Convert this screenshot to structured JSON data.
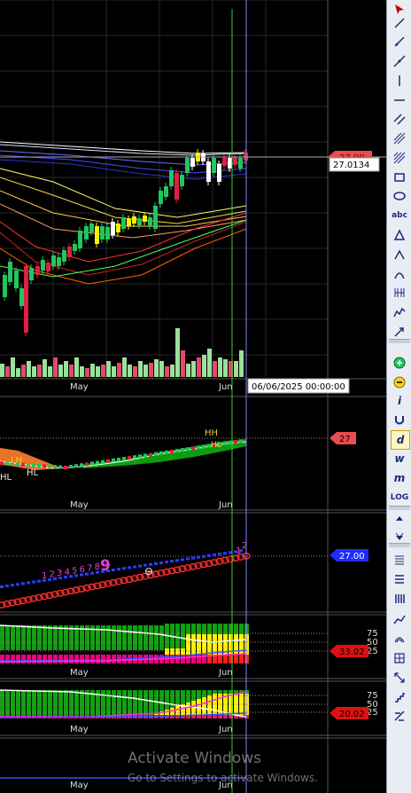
{
  "panels": {
    "main": {
      "last_price_label": "27.00",
      "crosshair_price": "27.0134",
      "crosshair_datetime": "06/06/2025 00:00:00",
      "x_labels": [
        "May",
        "Jun"
      ]
    },
    "trend": {
      "price_label": "27",
      "markers": [
        "HH",
        "HL",
        "LH",
        "HL",
        "HL"
      ],
      "x_labels": [
        "May",
        "Jun"
      ]
    },
    "count": {
      "price_label": "27.00",
      "sequence_digits": [
        "1",
        "2",
        "3",
        "4",
        "5",
        "6",
        "7",
        "8"
      ],
      "sequence_nine": "9",
      "right_digit_1": "1",
      "right_digit_2": "2"
    },
    "osc1": {
      "levels": [
        "75",
        "50",
        "25"
      ],
      "value_label": "33.02",
      "x_labels": [
        "May",
        "Jun"
      ]
    },
    "osc2": {
      "levels": [
        "75",
        "50",
        "25"
      ],
      "value_label": "20.02",
      "x_labels": [
        "May",
        "Jun"
      ]
    },
    "bottom": {
      "x_labels": [
        "May",
        "Jun"
      ]
    }
  },
  "colors": {
    "background": "#000000",
    "grid": "#3a3a3a",
    "up_candle": "#22c55e",
    "down_candle": "#e11d48",
    "neutral_candle": "#ffffff",
    "price_tag_red": "#e84c4c",
    "price_tag_blue": "#1e2cff",
    "crosshair_green": "#33cc33",
    "crosshair_violet": "#8080ff"
  },
  "toolbar": {
    "items": [
      {
        "icon": "cursor-arrow-icon"
      },
      {
        "icon": "trendline-icon"
      },
      {
        "icon": "ray-icon"
      },
      {
        "icon": "extended-line-icon"
      },
      {
        "icon": "vertical-line-icon"
      },
      {
        "icon": "horizontal-line-icon"
      },
      {
        "icon": "parallel-lines-icon"
      },
      {
        "icon": "pitchfork-icon"
      },
      {
        "icon": "grid-fan-icon"
      },
      {
        "icon": "rectangle-icon"
      },
      {
        "icon": "ellipse-icon"
      },
      {
        "icon": "text-icon",
        "label": "abc"
      },
      {
        "icon": "triangle-icon"
      },
      {
        "icon": "circle-icon"
      },
      {
        "icon": "arc-icon"
      },
      {
        "icon": "fibonacci-timezone-icon"
      },
      {
        "icon": "wave-icon"
      },
      {
        "icon": "arrow-pen-icon"
      },
      {
        "icon": "zoom-in-icon"
      },
      {
        "icon": "zoom-out-icon"
      },
      {
        "icon": "info-icon",
        "label": "i"
      },
      {
        "icon": "magnet-icon"
      },
      {
        "icon": "daily-interval-icon",
        "label": "d"
      },
      {
        "icon": "weekly-interval-icon",
        "label": "w"
      },
      {
        "icon": "monthly-interval-icon",
        "label": "m"
      },
      {
        "icon": "log-scale-icon",
        "label": "LOG"
      },
      {
        "icon": "scroll-up-icon"
      },
      {
        "icon": "scroll-down-icon"
      },
      {
        "icon": "list-icon"
      },
      {
        "icon": "split-layout-icon"
      },
      {
        "icon": "bars-icon"
      },
      {
        "icon": "candles-icon"
      },
      {
        "icon": "arch-icon"
      },
      {
        "icon": "table-icon"
      },
      {
        "icon": "expand-icon"
      },
      {
        "icon": "stairs-icon"
      },
      {
        "icon": "settings-icon"
      }
    ]
  },
  "watermark": {
    "title": "Activate Windows",
    "subtitle": "Go to Settings to activate Windows."
  }
}
